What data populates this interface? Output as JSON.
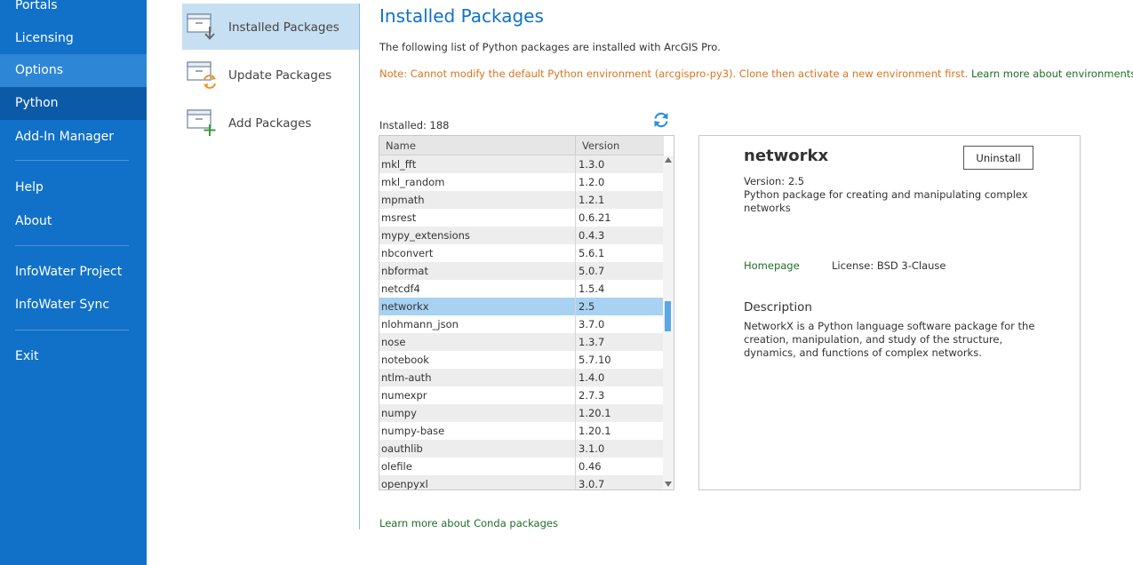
{
  "nav": {
    "items": [
      {
        "label": "Portals",
        "state": "normal"
      },
      {
        "label": "Licensing",
        "state": "normal"
      },
      {
        "label": "Options",
        "state": "hover"
      },
      {
        "label": "Python",
        "state": "selected"
      },
      {
        "label": "Add-In Manager",
        "state": "normal"
      },
      {
        "label": "Help",
        "state": "normal"
      },
      {
        "label": "About",
        "state": "normal"
      },
      {
        "label": "InfoWater Project",
        "state": "normal"
      },
      {
        "label": "InfoWater Sync",
        "state": "normal"
      },
      {
        "label": "Exit",
        "state": "normal"
      }
    ]
  },
  "subnav": {
    "items": [
      {
        "label": "Installed Packages",
        "icon": "installed-packages-icon"
      },
      {
        "label": "Update Packages",
        "icon": "update-packages-icon"
      },
      {
        "label": "Add Packages",
        "icon": "add-packages-icon"
      }
    ]
  },
  "main": {
    "title": "Installed Packages",
    "intro": "The following list of Python packages are installed with ArcGIS Pro.",
    "note_warning": "Note: Cannot modify the default Python environment (arcgispro-py3). Clone then activate a new environment first.",
    "note_link": "Learn more about environments.",
    "installed_label": "Installed:  188",
    "conda_link": "Learn more about Conda packages"
  },
  "table": {
    "headers": {
      "name": "Name",
      "version": "Version"
    },
    "rows": [
      {
        "name": "mkl_fft",
        "version": "1.3.0"
      },
      {
        "name": "mkl_random",
        "version": "1.2.0"
      },
      {
        "name": "mpmath",
        "version": "1.2.1"
      },
      {
        "name": "msrest",
        "version": "0.6.21"
      },
      {
        "name": "mypy_extensions",
        "version": "0.4.3"
      },
      {
        "name": "nbconvert",
        "version": "5.6.1"
      },
      {
        "name": "nbformat",
        "version": "5.0.7"
      },
      {
        "name": "netcdf4",
        "version": "1.5.4"
      },
      {
        "name": "networkx",
        "version": "2.5",
        "selected": true
      },
      {
        "name": "nlohmann_json",
        "version": "3.7.0"
      },
      {
        "name": "nose",
        "version": "1.3.7"
      },
      {
        "name": "notebook",
        "version": "5.7.10"
      },
      {
        "name": "ntlm-auth",
        "version": "1.4.0"
      },
      {
        "name": "numexpr",
        "version": "2.7.3"
      },
      {
        "name": "numpy",
        "version": "1.20.1"
      },
      {
        "name": "numpy-base",
        "version": "1.20.1"
      },
      {
        "name": "oauthlib",
        "version": "3.1.0"
      },
      {
        "name": "olefile",
        "version": "0.46"
      },
      {
        "name": "openpyxl",
        "version": "3.0.7"
      }
    ]
  },
  "details": {
    "name": "networkx",
    "uninstall_label": "Uninstall",
    "version": "Version:  2.5",
    "summary": "Python package for creating and manipulating complex networks",
    "homepage_label": "Homepage",
    "license": "License:  BSD 3-Clause",
    "description_title": "Description",
    "description": "NetworkX is a Python language software package for the creation, manipulation, and study of the structure, dynamics, and functions of complex networks."
  },
  "colors": {
    "nav_bg": "#1171c9",
    "accent": "#1171c9",
    "warning": "#d7751f",
    "link": "#1f6e2a",
    "selection": "#a8d2f2"
  }
}
